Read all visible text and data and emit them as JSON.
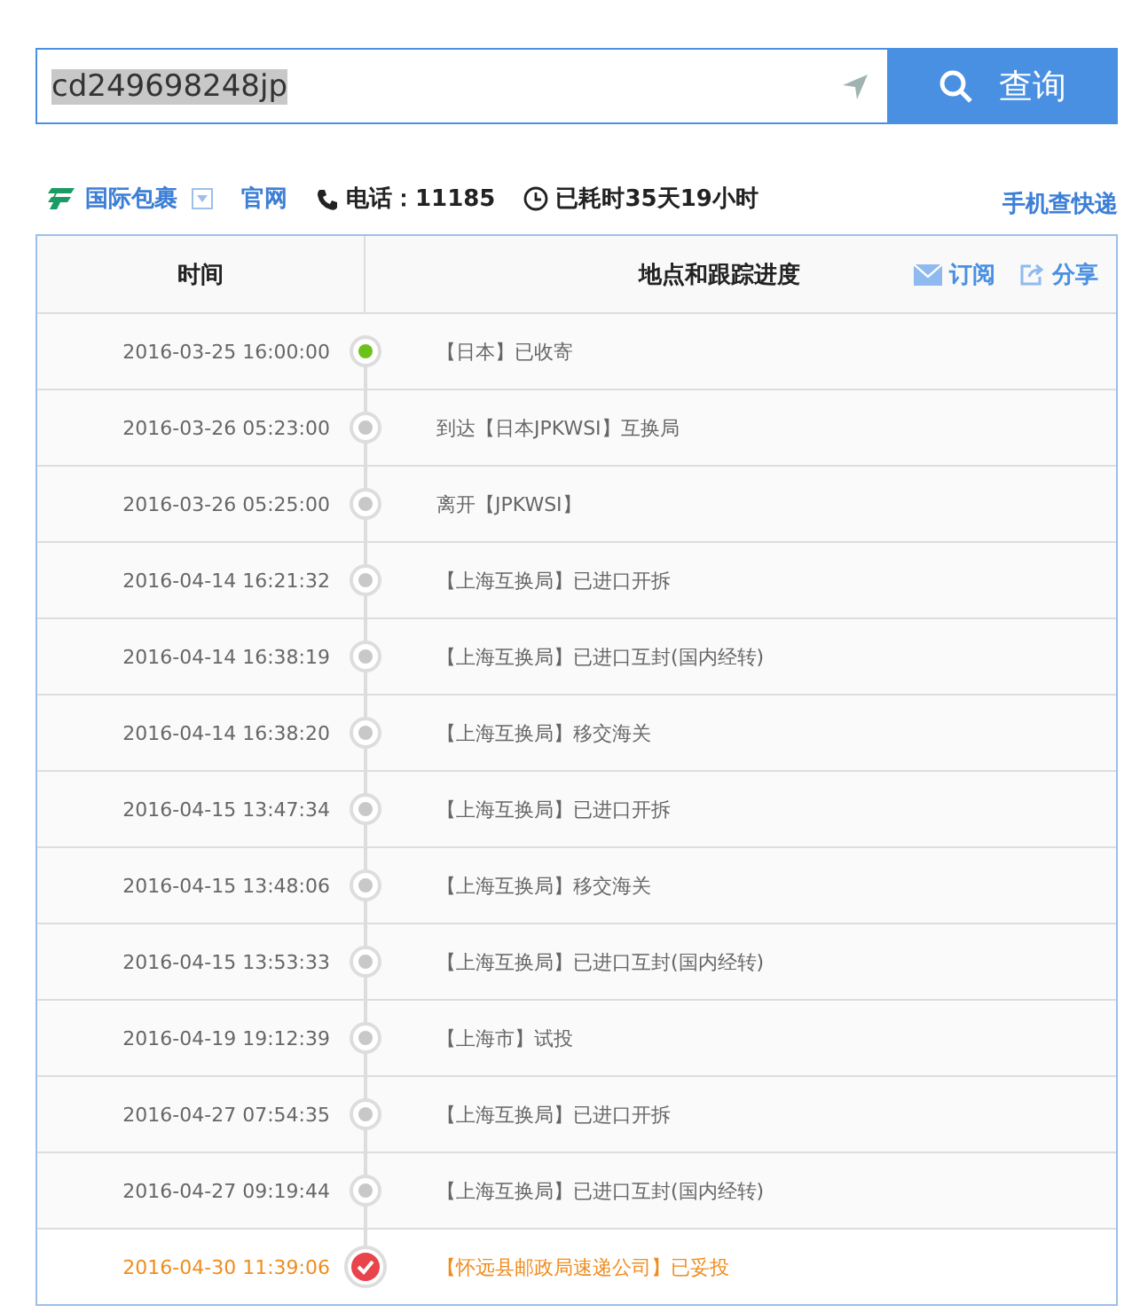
{
  "search": {
    "value": "cd249698248jp",
    "value_selected": true,
    "button": "查询"
  },
  "info": {
    "carrier": "国际包裹",
    "official_site": "官网",
    "phone_label": "电话：",
    "phone": "11185",
    "elapsed": "已耗时35天19小时",
    "mobile_link": "手机查快递"
  },
  "table": {
    "columns": [
      "时间",
      "地点和跟踪进度"
    ],
    "subscribe": "订阅",
    "share": "分享",
    "rows": [
      {
        "time": "2016-03-25 16:00:00",
        "event": "【日本】已收寄",
        "kind": "start"
      },
      {
        "time": "2016-03-26 05:23:00",
        "event": "到达【日本JPKWSI】互换局",
        "kind": "normal"
      },
      {
        "time": "2016-03-26 05:25:00",
        "event": "离开【JPKWSI】",
        "kind": "normal"
      },
      {
        "time": "2016-04-14 16:21:32",
        "event": "【上海互换局】已进口开拆",
        "kind": "normal"
      },
      {
        "time": "2016-04-14 16:38:19",
        "event": "【上海互换局】已进口互封(国内经转)",
        "kind": "normal"
      },
      {
        "time": "2016-04-14 16:38:20",
        "event": "【上海互换局】移交海关",
        "kind": "normal"
      },
      {
        "time": "2016-04-15 13:47:34",
        "event": "【上海互换局】已进口开拆",
        "kind": "normal"
      },
      {
        "time": "2016-04-15 13:48:06",
        "event": "【上海互换局】移交海关",
        "kind": "normal"
      },
      {
        "time": "2016-04-15 13:53:33",
        "event": "【上海互换局】已进口互封(国内经转)",
        "kind": "normal"
      },
      {
        "time": "2016-04-19 19:12:39",
        "event": "【上海市】试投",
        "kind": "normal"
      },
      {
        "time": "2016-04-27 07:54:35",
        "event": "【上海互换局】已进口开拆",
        "kind": "normal"
      },
      {
        "time": "2016-04-27 09:19:44",
        "event": "【上海互换局】已进口互封(国内经转)",
        "kind": "normal"
      },
      {
        "time": "2016-04-30 11:39:06",
        "event": "【怀远县邮政局速递公司】已妥投",
        "kind": "delivered"
      }
    ]
  }
}
